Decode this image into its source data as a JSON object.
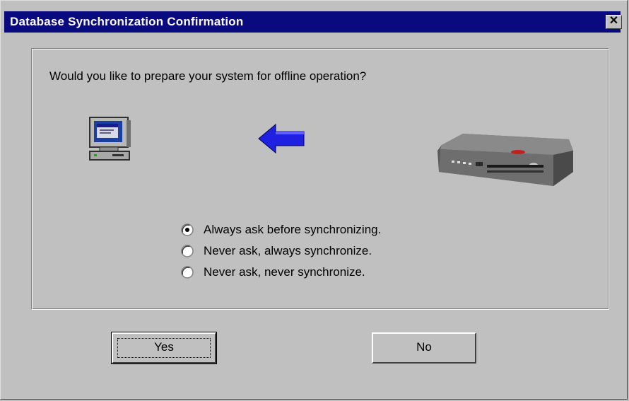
{
  "dialog": {
    "title": "Database Synchronization Confirmation",
    "close_label": "✕",
    "question": "Would you like to prepare your system for offline operation?",
    "icons": {
      "computer": "computer-icon",
      "arrow": "arrow-left-icon",
      "device": "network-appliance-image"
    },
    "arrow_color": "#2020e0",
    "options": [
      {
        "label": "Always ask before synchronizing.",
        "selected": true
      },
      {
        "label": "Never ask, always synchronize.",
        "selected": false
      },
      {
        "label": "Never ask, never synchronize.",
        "selected": false
      }
    ],
    "buttons": {
      "yes": "Yes",
      "no": "No"
    }
  },
  "colors": {
    "titlebar": "#0a0a80",
    "face": "#c0c0c0"
  }
}
